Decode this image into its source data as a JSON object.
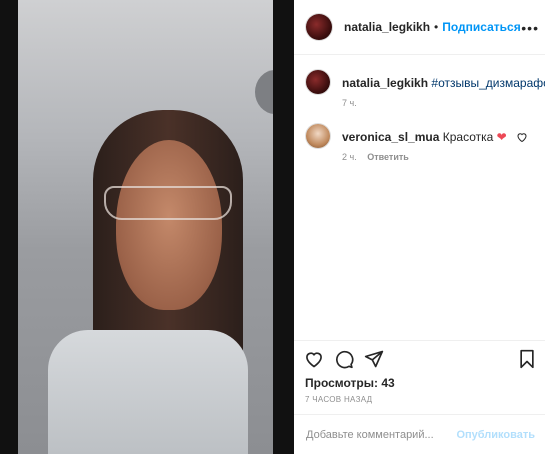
{
  "header": {
    "username": "natalia_legkikh",
    "separator": "•",
    "follow_label": "Подписаться",
    "more_icon": "more-horizontal-icon"
  },
  "caption": {
    "username": "natalia_legkikh",
    "text": "#отзывы_дизмарафон",
    "time": "7 ч."
  },
  "comments": [
    {
      "username": "veronica_sl_mua",
      "text": "Красотка",
      "emoji": "❤",
      "time": "2 ч.",
      "reply_label": "Ответить"
    }
  ],
  "actions": {
    "icons": [
      "heart-icon",
      "comment-icon",
      "share-icon",
      "bookmark-icon"
    ],
    "views_label": "Просмотры: 43",
    "posted_time": "7 ЧАСОВ НАЗАД"
  },
  "add_comment": {
    "placeholder": "Добавьте комментарий...",
    "post_label": "Опубликовать"
  },
  "colors": {
    "accent": "#0095f6",
    "hashtag": "#00376b",
    "heart": "#ed4956",
    "muted": "#8e8e8e",
    "post_disabled": "#b2dffc"
  }
}
